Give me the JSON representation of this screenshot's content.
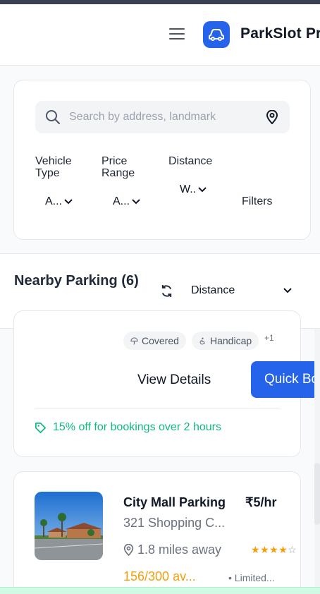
{
  "header": {
    "brand": "ParkSlot Pr",
    "menu_icon": "hamburger-menu-icon",
    "logo_icon": "car-icon",
    "brand_color": "#2563eb"
  },
  "search": {
    "placeholder": "Search by address, landmark",
    "search_icon": "search-icon",
    "location_icon": "map-pin-icon"
  },
  "filters": {
    "vehicle_type_label": "Vehicle Type",
    "vehicle_type_value": "A...",
    "price_range_label": "Price Range",
    "price_range_value": "A...",
    "distance_label": "Distance",
    "distance_value": "W..",
    "filters_button": "Filters"
  },
  "nearby": {
    "title": "Nearby Parking (6)",
    "sort_value": "Distance",
    "refresh_icon": "refresh-icon"
  },
  "card1": {
    "chips": [
      {
        "label": "Covered",
        "icon": "umbrella-icon"
      },
      {
        "label": "Handicap",
        "icon": "accessibility-icon"
      }
    ],
    "more_chips": "+1",
    "view_details": "View Details",
    "quick_book": "Quick Bo",
    "promo": "15% off for bookings over 2 hours",
    "promo_icon": "tag-icon",
    "promo_color": "#10b981"
  },
  "card2": {
    "name": "City Mall Parking",
    "price": "₹5/hr",
    "address": "321 Shopping C...",
    "distance": "1.8 miles away",
    "rating": 4,
    "rating_max": 5,
    "availability": "156/300 av...",
    "status": "• Limited...",
    "availability_color": "#f59e0b"
  }
}
